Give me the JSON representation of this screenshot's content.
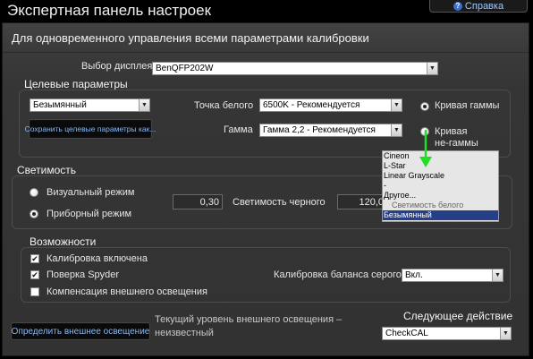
{
  "window": {
    "title": "Экспертная панель настроек",
    "help_label": "Справка",
    "help_icon": "question-circle-icon"
  },
  "subtitle": "Для одновременного управления всеми параметрами калибровки",
  "display": {
    "label": "Выбор дисплея",
    "value": "BenQFP202W"
  },
  "targets": {
    "heading": "Целевые параметры",
    "preset_value": "Безымянный",
    "save_button": "Сохранить целевые параметры как...",
    "white_point_label": "Точка белого",
    "white_point_value": "6500K - Рекомендуется",
    "gamma_label": "Гамма",
    "gamma_value": "Гамма 2,2 - Рекомендуется",
    "radio_gamma_curve": "Кривая гаммы",
    "radio_non_gamma_line1": "Кривая",
    "radio_non_gamma_line2": "не-гаммы"
  },
  "popup": {
    "options": [
      "Cineon",
      "L-Star",
      "Linear Grayscale",
      "-",
      "Другое..."
    ],
    "overlap_text": "Светимость белого",
    "selected": "Безымянный"
  },
  "luminance": {
    "heading": "Светимость",
    "visual_mode": "Визуальный режим",
    "device_mode": "Приборный режим",
    "black_value": "0,30",
    "black_label": "Светимость черного",
    "white_value": "120,0"
  },
  "features": {
    "heading": "Возможности",
    "calibration_enabled": "Калибровка включена",
    "spyder_check": "Поверка Spyder",
    "ambient_comp": "Компенсация внешнего освещения",
    "gray_balance_label": "Калибровка баланса серого",
    "gray_balance_value": "Вкл."
  },
  "ambient": {
    "button": "Определить внешнее освещение",
    "status_line1": "Текущий уровень внешнего освещения –",
    "status_line2": "неизвестный"
  },
  "next": {
    "label": "Следующее действие",
    "value": "CheckCAL"
  },
  "colors": {
    "accent_link": "#8ab8f0",
    "arrow": "#22dd22",
    "selection": "#263f87"
  }
}
